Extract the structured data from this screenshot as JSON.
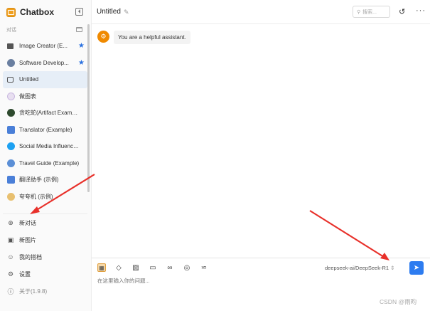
{
  "app": {
    "name": "Chatbox"
  },
  "sidebar": {
    "section_label": "对话",
    "conversations": [
      {
        "label": "Image Creator (E...",
        "icon": "image-icon",
        "starred": true,
        "star": "★"
      },
      {
        "label": "Software Develop...",
        "icon": "developer-avatar-icon",
        "starred": true,
        "star": "★"
      },
      {
        "label": "Untitled",
        "icon": "chat-bubble-icon",
        "active": true
      },
      {
        "label": "做图表",
        "icon": "chart-avatar-icon"
      },
      {
        "label": "贪吃蛇(Artifact Example)",
        "icon": "snake-avatar-icon"
      },
      {
        "label": "Translator (Example)",
        "icon": "translator-avatar-icon"
      },
      {
        "label": "Social Media Influence...",
        "icon": "twitter-icon"
      },
      {
        "label": "Travel Guide (Example)",
        "icon": "globe-icon"
      },
      {
        "label": "翻译助手 (示例)",
        "icon": "translator-avatar-icon"
      },
      {
        "label": "夸夸机 (示例)",
        "icon": "praise-avatar-icon"
      }
    ],
    "bottom_menu": {
      "new_chat": "新对话",
      "new_image": "新图片",
      "my_partners": "我的搭档",
      "settings": "设置",
      "about": "关于(1.9.8)"
    }
  },
  "header": {
    "title": "Untitled",
    "search_placeholder": "搜索..."
  },
  "messages": [
    {
      "role": "system",
      "text": "You are a helpful assistant."
    }
  ],
  "composer": {
    "model": "deepseek-ai/DeepSeek-R1",
    "placeholder": "在这里输入你的问题..."
  },
  "watermark": "CSDN @雨昀",
  "colors": {
    "accent": "#2d7cf0",
    "brand": "#f0a020",
    "annotation_arrow": "#e8302a"
  }
}
